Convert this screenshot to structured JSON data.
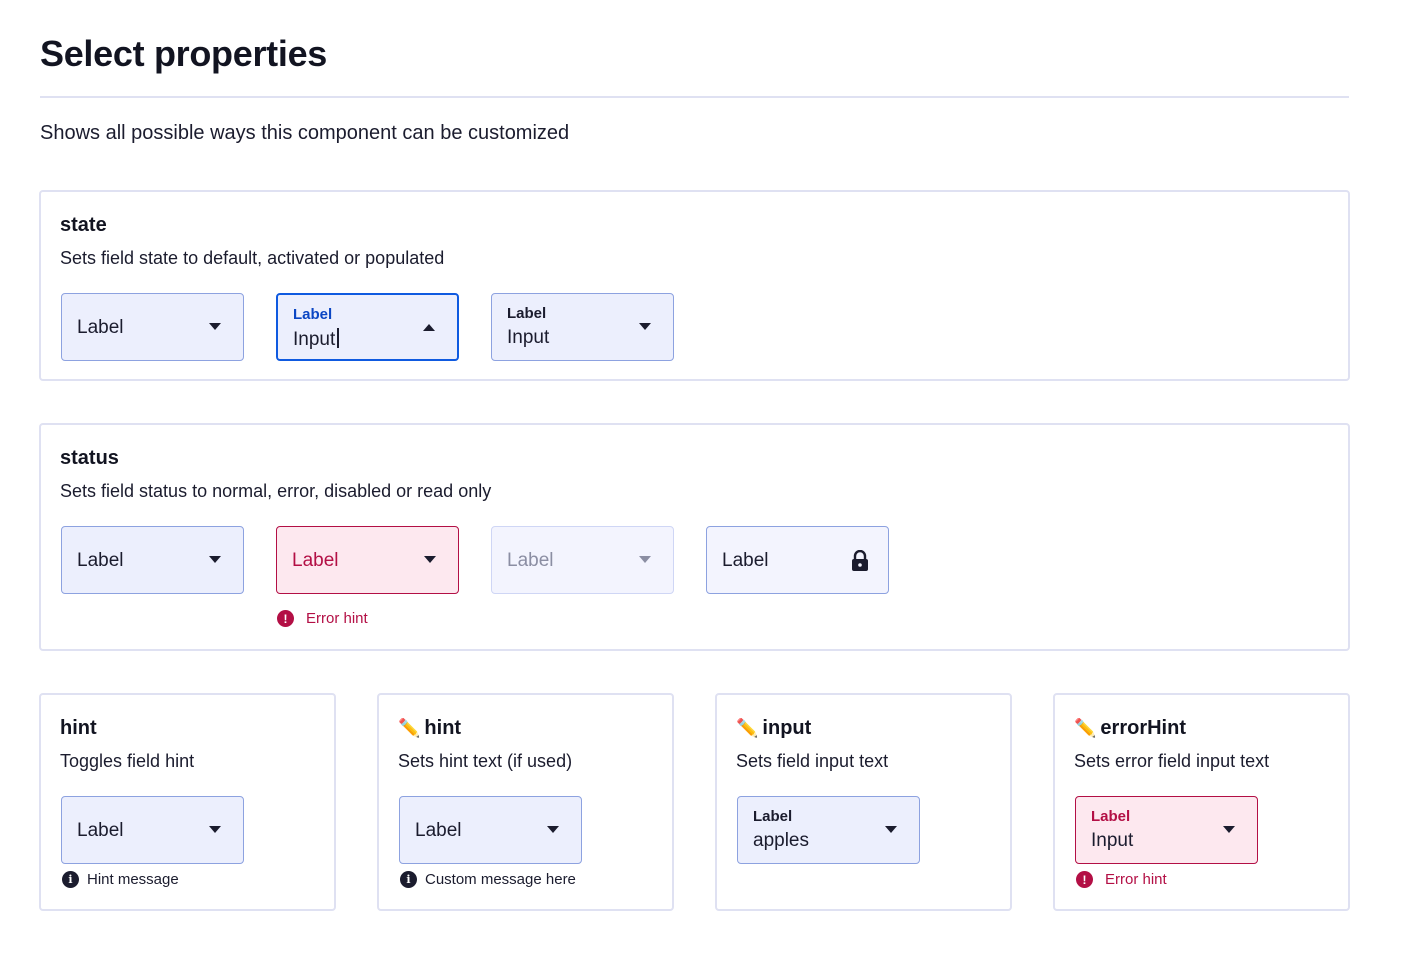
{
  "page": {
    "title": "Select properties",
    "description": "Shows all possible ways this component can be customized"
  },
  "state_card": {
    "title": "state",
    "description": "Sets field state to default, activated or populated",
    "default_field": {
      "label": "Label"
    },
    "activated_field": {
      "label": "Label",
      "value": "Input"
    },
    "populated_field": {
      "label": "Label",
      "value": "Input"
    }
  },
  "status_card": {
    "title": "status",
    "description": "Sets field status to normal, error, disabled or read only",
    "normal_field": {
      "label": "Label"
    },
    "error_field": {
      "label": "Label",
      "hint": "Error hint"
    },
    "disabled_field": {
      "label": "Label"
    },
    "readonly_field": {
      "label": "Label"
    }
  },
  "hint_card": {
    "title": "hint",
    "description": "Toggles field hint",
    "field": {
      "label": "Label",
      "hint": "Hint message"
    }
  },
  "hint_text_card": {
    "title": "hint",
    "description": "Sets hint text (if used)",
    "field": {
      "label": "Label",
      "hint": "Custom message here"
    }
  },
  "input_card": {
    "title": "input",
    "description": "Sets field input text",
    "field": {
      "label": "Label",
      "value": "apples"
    }
  },
  "error_hint_card": {
    "title": "errorHint",
    "description": "Sets error field input text",
    "field": {
      "label": "Label",
      "value": "Input",
      "hint": "Error hint"
    }
  },
  "icons": {
    "dropdown": "chevron-down-icon",
    "dropdown_open": "chevron-up-icon",
    "info": "info-icon",
    "error": "error-icon",
    "lock": "lock-icon",
    "edit": "pencil-icon"
  },
  "colors": {
    "accent": "#0f5ae0",
    "error": "#b30f45",
    "field_border": "#8da2e0",
    "field_bg": "#eceffd",
    "text": "#1b1c2e"
  }
}
